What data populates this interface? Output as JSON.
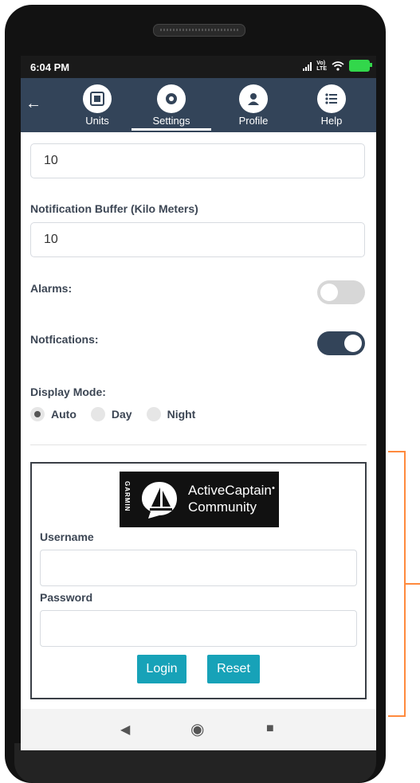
{
  "status_bar": {
    "time": "6:04 PM"
  },
  "nav": {
    "tabs": [
      {
        "label": "Units",
        "icon": "units-icon"
      },
      {
        "label": "Settings",
        "icon": "gear-icon",
        "active": true
      },
      {
        "label": "Profile",
        "icon": "user-icon"
      },
      {
        "label": "Help",
        "icon": "list-icon"
      }
    ]
  },
  "settings": {
    "top_value": "10",
    "notification_buffer_label": "Notification Buffer (Kilo Meters)",
    "notification_buffer_value": "10",
    "alarms_label": "Alarms:",
    "alarms_on": false,
    "notifications_label": "Notfications:",
    "notifications_on": true,
    "display_mode_label": "Display Mode:",
    "display_modes": [
      "Auto",
      "Day",
      "Night"
    ],
    "display_mode_selected": "Auto"
  },
  "login": {
    "logo_brand": "GARMIN",
    "logo_line1": "ActiveCaptain",
    "logo_line2": "Community",
    "username_label": "Username",
    "password_label": "Password",
    "login_button": "Login",
    "reset_button": "Reset"
  },
  "colors": {
    "nav_bg": "#334459",
    "toggle_on": "#334459",
    "toggle_off": "#d7d7d7",
    "button": "#17a2b8",
    "annotation": "#ff8a3d"
  }
}
